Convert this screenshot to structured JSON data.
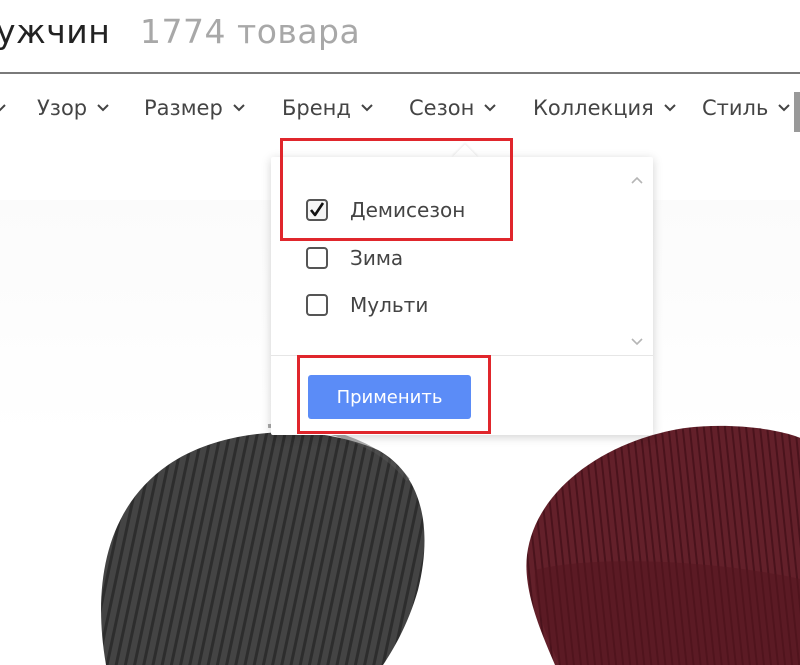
{
  "header": {
    "title": "ужчин",
    "product_count": "1774 товара"
  },
  "filter_bar": {
    "items": [
      {
        "label": "Узор"
      },
      {
        "label": "Размер"
      },
      {
        "label": "Бренд"
      },
      {
        "label": "Сезон"
      },
      {
        "label": "Коллекция"
      },
      {
        "label": "Стиль"
      }
    ],
    "active": "Сезон"
  },
  "season_dropdown": {
    "options": [
      {
        "label": "Демисезон",
        "checked": true
      },
      {
        "label": "Зима",
        "checked": false
      },
      {
        "label": "Мульти",
        "checked": false
      }
    ],
    "apply_label": "Применить"
  },
  "products": [
    {
      "icon": "gray-beanie-hat-image",
      "color": "#3d3d3d"
    },
    {
      "icon": "burgundy-beanie-hat-image",
      "color": "#5e1a24"
    }
  ],
  "colors": {
    "accent_button": "#5b8cf7",
    "highlight": "#e0262c"
  },
  "icons": {
    "filter_chevron": "chevron-down-icon",
    "checkbox_check": "check-icon",
    "scroll_up": "scroll-up-icon",
    "scroll_down": "scroll-down-icon"
  }
}
